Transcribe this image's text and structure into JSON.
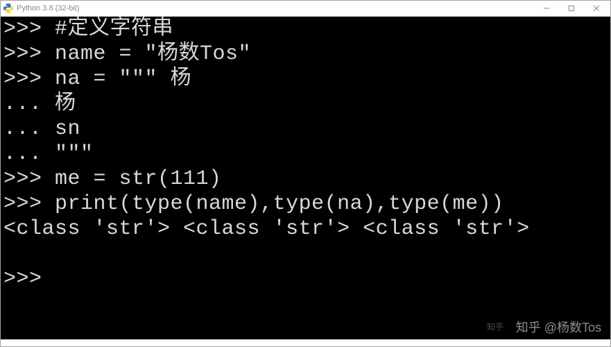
{
  "window": {
    "title": "Python 3.8 (32-bit)",
    "controls": {
      "minimize": "−",
      "maximize": "□",
      "close": "×"
    }
  },
  "terminal": {
    "lines": [
      ">>> #定义字符串",
      ">>> name = \"杨数Tos\"",
      ">>> na = \"\"\" 杨",
      "... 杨",
      "... sn",
      "... \"\"\"",
      ">>> me = str(111)",
      ">>> print(type(name),type(na),type(me))",
      "<class 'str'> <class 'str'> <class 'str'>",
      "",
      ">>>"
    ]
  },
  "watermark": {
    "text": "知乎 @杨数Tos"
  },
  "caption": ""
}
